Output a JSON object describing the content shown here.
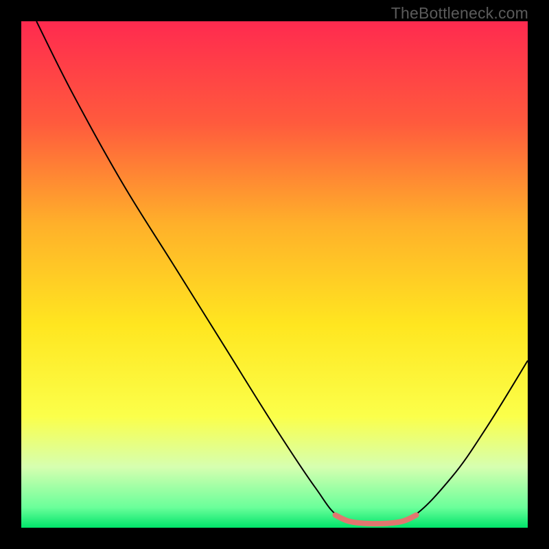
{
  "watermark": "TheBottleneck.com",
  "chart_data": {
    "type": "line",
    "title": "",
    "xlabel": "",
    "ylabel": "",
    "xlim": [
      0,
      100
    ],
    "ylim": [
      0,
      100
    ],
    "grid": false,
    "legend": false,
    "background_gradient": {
      "stops": [
        {
          "pct": 0,
          "color": "#ff2a4f"
        },
        {
          "pct": 20,
          "color": "#ff5a3d"
        },
        {
          "pct": 40,
          "color": "#ffb02a"
        },
        {
          "pct": 60,
          "color": "#ffe620"
        },
        {
          "pct": 78,
          "color": "#fbff4a"
        },
        {
          "pct": 88,
          "color": "#d6ffb0"
        },
        {
          "pct": 96,
          "color": "#6aff9a"
        },
        {
          "pct": 100,
          "color": "#00e46a"
        }
      ]
    },
    "series": [
      {
        "name": "bottleneck-curve",
        "stroke": "#000000",
        "stroke_width": 2,
        "data": [
          {
            "x": 3,
            "y": 100
          },
          {
            "x": 10,
            "y": 86
          },
          {
            "x": 20,
            "y": 68
          },
          {
            "x": 30,
            "y": 52
          },
          {
            "x": 40,
            "y": 36
          },
          {
            "x": 50,
            "y": 20
          },
          {
            "x": 58,
            "y": 8
          },
          {
            "x": 63,
            "y": 2
          },
          {
            "x": 70,
            "y": 0.5
          },
          {
            "x": 77,
            "y": 2
          },
          {
            "x": 85,
            "y": 10
          },
          {
            "x": 92,
            "y": 20
          },
          {
            "x": 100,
            "y": 33
          }
        ]
      },
      {
        "name": "optimal-zone-highlight",
        "stroke": "#e2766f",
        "stroke_width": 8,
        "data": [
          {
            "x": 62,
            "y": 2.5
          },
          {
            "x": 65,
            "y": 1.2
          },
          {
            "x": 70,
            "y": 0.8
          },
          {
            "x": 75,
            "y": 1.2
          },
          {
            "x": 78,
            "y": 2.5
          }
        ]
      }
    ]
  }
}
